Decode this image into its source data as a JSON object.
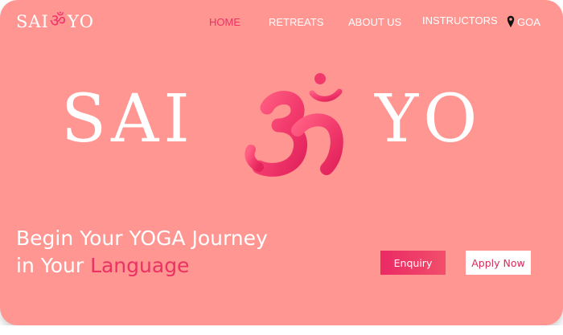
{
  "logo": {
    "left": "SAI",
    "symbol": "ॐ",
    "right": "YO"
  },
  "nav": {
    "items": [
      {
        "label": "HOME",
        "active": true
      },
      {
        "label": "RETREATS",
        "active": false
      },
      {
        "label": "ABOUT US",
        "active": false
      },
      {
        "label": "INSTRUCTORS",
        "active": false
      }
    ],
    "location": {
      "label": "GOA",
      "icon": "location-pin-icon"
    }
  },
  "hero": {
    "left": "SAI",
    "symbol": "ॐ",
    "right": "YO"
  },
  "tagline": {
    "line1": "Begin Your YOGA Journey",
    "line2_prefix": "in Your ",
    "line2_accent": "Language"
  },
  "buttons": {
    "enquiry": "Enquiry",
    "apply": "Apply Now"
  },
  "colors": {
    "background": "#ff9692",
    "accent": "#ec3263",
    "text": "#ffffff"
  }
}
